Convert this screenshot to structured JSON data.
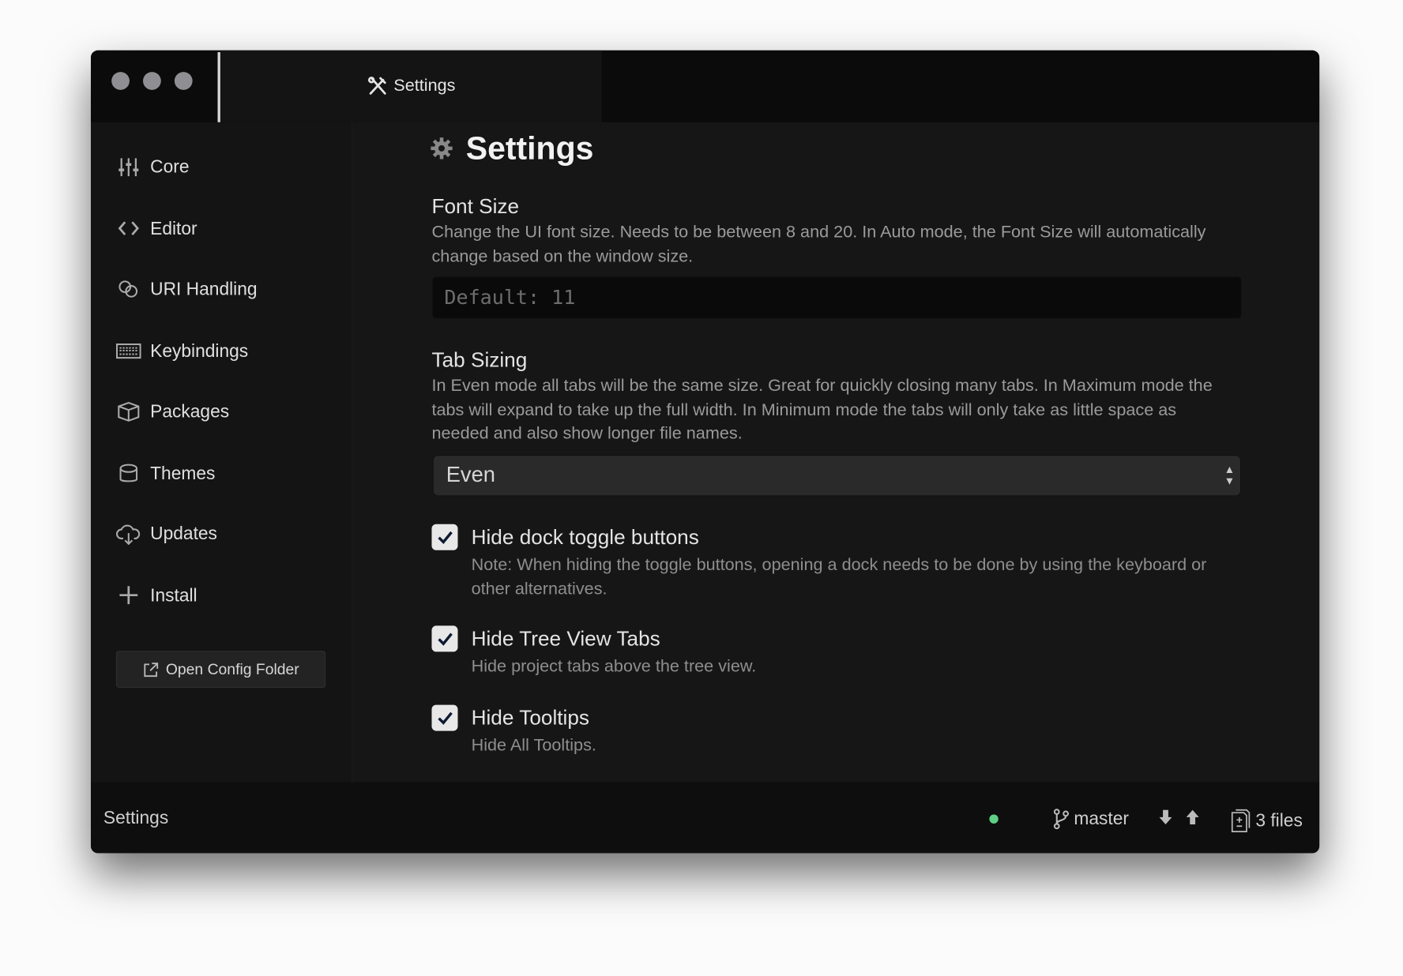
{
  "window": {
    "tab_title": "Settings",
    "tab_icon": "tools-icon"
  },
  "sidebar": {
    "items": [
      {
        "label": "Core",
        "icon": "sliders-icon"
      },
      {
        "label": "Editor",
        "icon": "code-icon"
      },
      {
        "label": "URI Handling",
        "icon": "link-icon"
      },
      {
        "label": "Keybindings",
        "icon": "keyboard-icon"
      },
      {
        "label": "Packages",
        "icon": "package-icon"
      },
      {
        "label": "Themes",
        "icon": "paintcan-icon"
      },
      {
        "label": "Updates",
        "icon": "cloud-download-icon"
      },
      {
        "label": "Install",
        "icon": "plus-icon"
      }
    ],
    "open_config_label": "Open Config Folder"
  },
  "main": {
    "title": "Settings",
    "font_size": {
      "title": "Font Size",
      "description": "Change the UI font size. Needs to be between 8 and 20. In Auto mode, the Font Size will automatically change based on the window size.",
      "placeholder": "Default: 11"
    },
    "tab_sizing": {
      "title": "Tab Sizing",
      "description": "In Even mode all tabs will be the same size. Great for quickly closing many tabs. In Maximum mode the tabs will expand to take up the full width. In Minimum mode the tabs will only take as little space as needed and also show longer file names.",
      "selected": "Even"
    },
    "checkboxes": [
      {
        "label": "Hide dock toggle buttons",
        "description": "Note: When hiding the toggle buttons, opening a dock needs to be done by using the keyboard or other alternatives.",
        "checked": true
      },
      {
        "label": "Hide Tree View Tabs",
        "description": "Hide project tabs above the tree view.",
        "checked": true
      },
      {
        "label": "Hide Tooltips",
        "description": "Hide All Tooltips.",
        "checked": true
      }
    ]
  },
  "status_bar": {
    "left": "Settings",
    "indicator_color": "#5fcf86",
    "branch": "master",
    "files": "3 files"
  }
}
